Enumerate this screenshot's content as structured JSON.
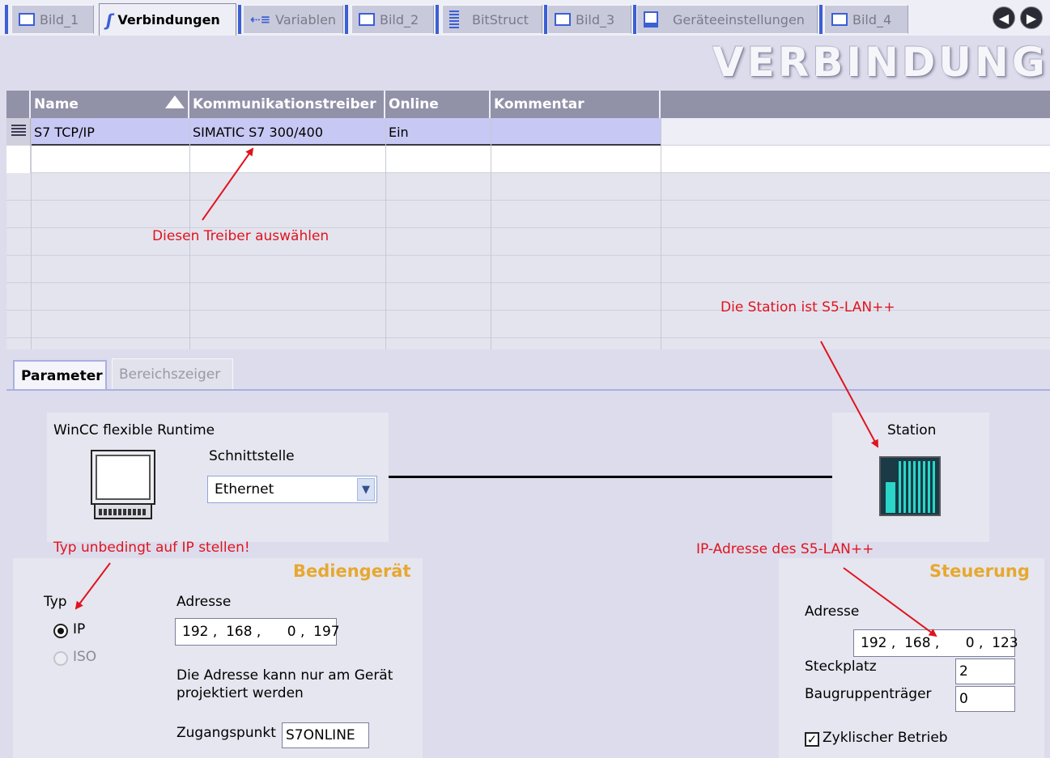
{
  "tabs": [
    {
      "label": "Bild_1",
      "icon": "screen-icon"
    },
    {
      "label": "Verbindungen",
      "icon": "connections-icon",
      "active": true
    },
    {
      "label": "Variablen",
      "icon": "variables-icon"
    },
    {
      "label": "Bild_2",
      "icon": "screen-icon"
    },
    {
      "label": "BitStruct",
      "icon": "bitstruct-icon"
    },
    {
      "label": "Bild_3",
      "icon": "screen-icon"
    },
    {
      "label": "Geräteeinstellungen",
      "icon": "device-settings-icon"
    },
    {
      "label": "Bild_4",
      "icon": "screen-icon"
    }
  ],
  "nav": {
    "prev_glyph": "◀",
    "next_glyph": "▶"
  },
  "banner_title": "VERBINDUNGEN",
  "grid": {
    "columns": [
      "Name",
      "Kommunikationstreiber",
      "Online",
      "Kommentar"
    ],
    "rows": [
      {
        "name": "S7 TCP/IP",
        "driver": "SIMATIC S7 300/400",
        "online": "Ein",
        "comment": ""
      }
    ]
  },
  "subtabs": {
    "parameter": "Parameter",
    "bereichszeiger": "Bereichszeiger"
  },
  "runtime": {
    "title": "WinCC flexible Runtime",
    "schnittstelle_label": "Schnittstelle",
    "schnittstelle_value": "Ethernet"
  },
  "station": {
    "label": "Station"
  },
  "bediengeraet": {
    "title": "Bediengerät",
    "typ_label": "Typ",
    "option_ip": "IP",
    "option_iso": "ISO",
    "adresse_label": "Adresse",
    "adresse_value": "192 ,  168 ,      0 ,  197",
    "note": "Die Adresse kann nur am Gerät projektiert werden",
    "zugangspunkt_label": "Zugangspunkt",
    "zugangspunkt_value": "S7ONLINE"
  },
  "steuerung": {
    "title": "Steuerung",
    "adresse_label": "Adresse",
    "adresse_value": "192 ,  168 ,      0 ,  123",
    "steckplatz_label": "Steckplatz",
    "steckplatz_value": "2",
    "baugruppentraeger_label": "Baugruppenträger",
    "baugruppentraeger_value": "0",
    "zyklisch_label": "Zyklischer Betrieb",
    "zyklisch_checked": true
  },
  "annotations": {
    "treiber": "Diesen Treiber auswählen",
    "station": "Die Station ist S5-LAN++",
    "typ": "Typ unbedingt auf IP stellen!",
    "ip": "IP-Adresse des S5-LAN++"
  },
  "colors": {
    "annotation": "#e0141e",
    "section_title": "#e6a830",
    "selected_row": "#c8c8f4",
    "header": "#9191a8"
  }
}
